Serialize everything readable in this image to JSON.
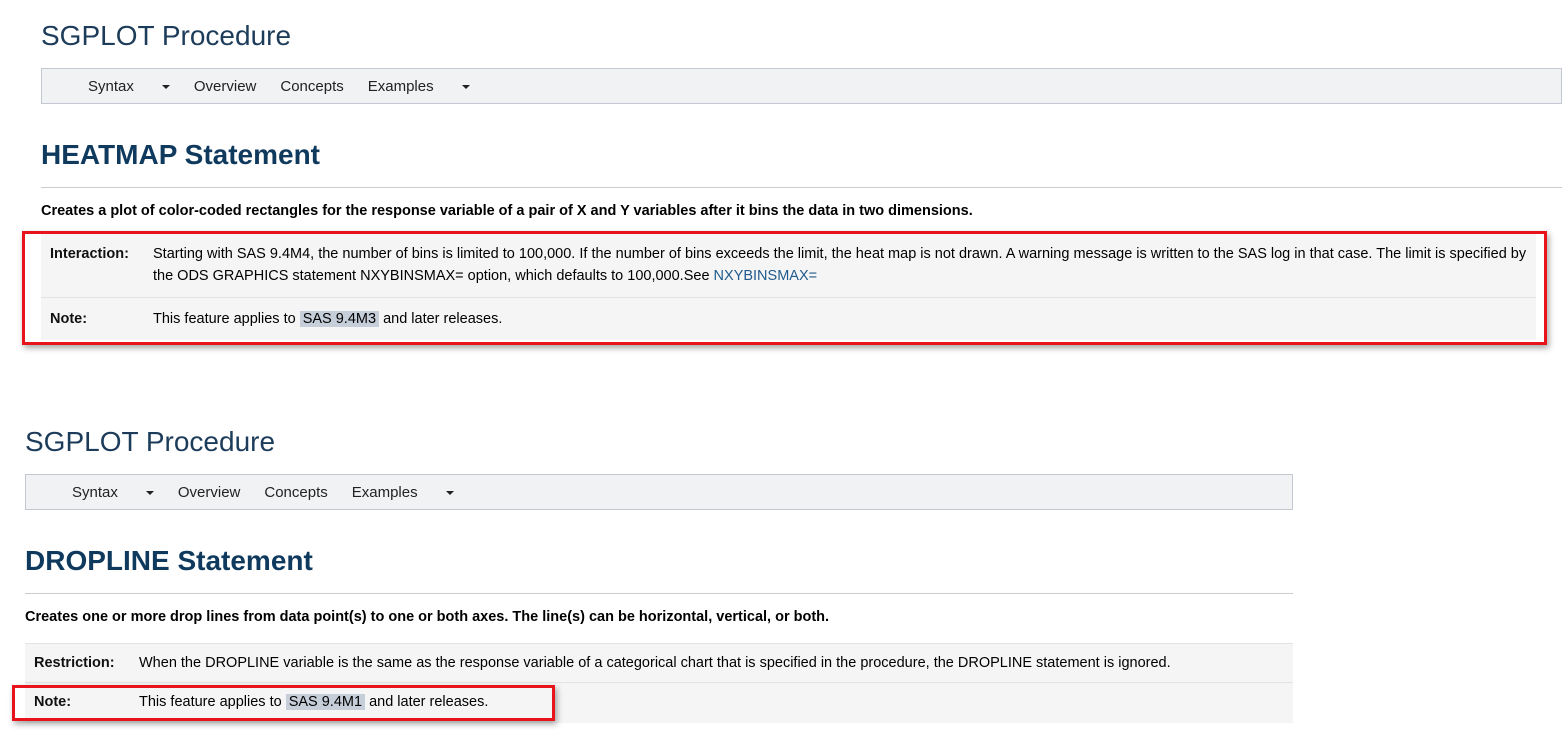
{
  "top": {
    "procedure_title": "SGPLOT Procedure",
    "nav": [
      {
        "label": "Syntax",
        "dropdown": true
      },
      {
        "label": "Overview"
      },
      {
        "label": "Concepts"
      },
      {
        "label": "Examples",
        "dropdown": true
      }
    ],
    "heading": "HEATMAP Statement",
    "description": "Creates a plot of color-coded rectangles for the response variable of a pair of X and Y variables after it bins the data in two dimensions.",
    "rows": [
      {
        "label": "Interaction:",
        "text": "Starting with SAS 9.4M4, the number of bins is limited to 100,000. If the number of bins exceeds the limit, the heat map is not drawn. A warning message is written to the SAS log in that case. The limit is specified by the ODS GRAPHICS statement NXYBINSMAX= option, which defaults to 100,000.See ",
        "link": "NXYBINSMAX="
      },
      {
        "label": "Note:",
        "pre": "This feature applies to ",
        "highlight": "SAS 9.4M3",
        "post": " and later releases."
      }
    ]
  },
  "bottom": {
    "procedure_title": "SGPLOT Procedure",
    "nav": [
      {
        "label": "Syntax",
        "dropdown": true
      },
      {
        "label": "Overview"
      },
      {
        "label": "Concepts"
      },
      {
        "label": "Examples",
        "dropdown": true
      }
    ],
    "heading": "DROPLINE Statement",
    "description": "Creates one or more drop lines from data point(s) to one or both axes. The line(s) can be horizontal, vertical, or both.",
    "rows": [
      {
        "label": "Restriction:",
        "text": "When the DROPLINE variable is the same as the response variable of a categorical chart that is specified in the procedure, the DROPLINE statement is ignored."
      },
      {
        "label": "Note:",
        "pre": "This feature applies to ",
        "highlight": "SAS 9.4M1",
        "post": " and later releases."
      }
    ]
  }
}
